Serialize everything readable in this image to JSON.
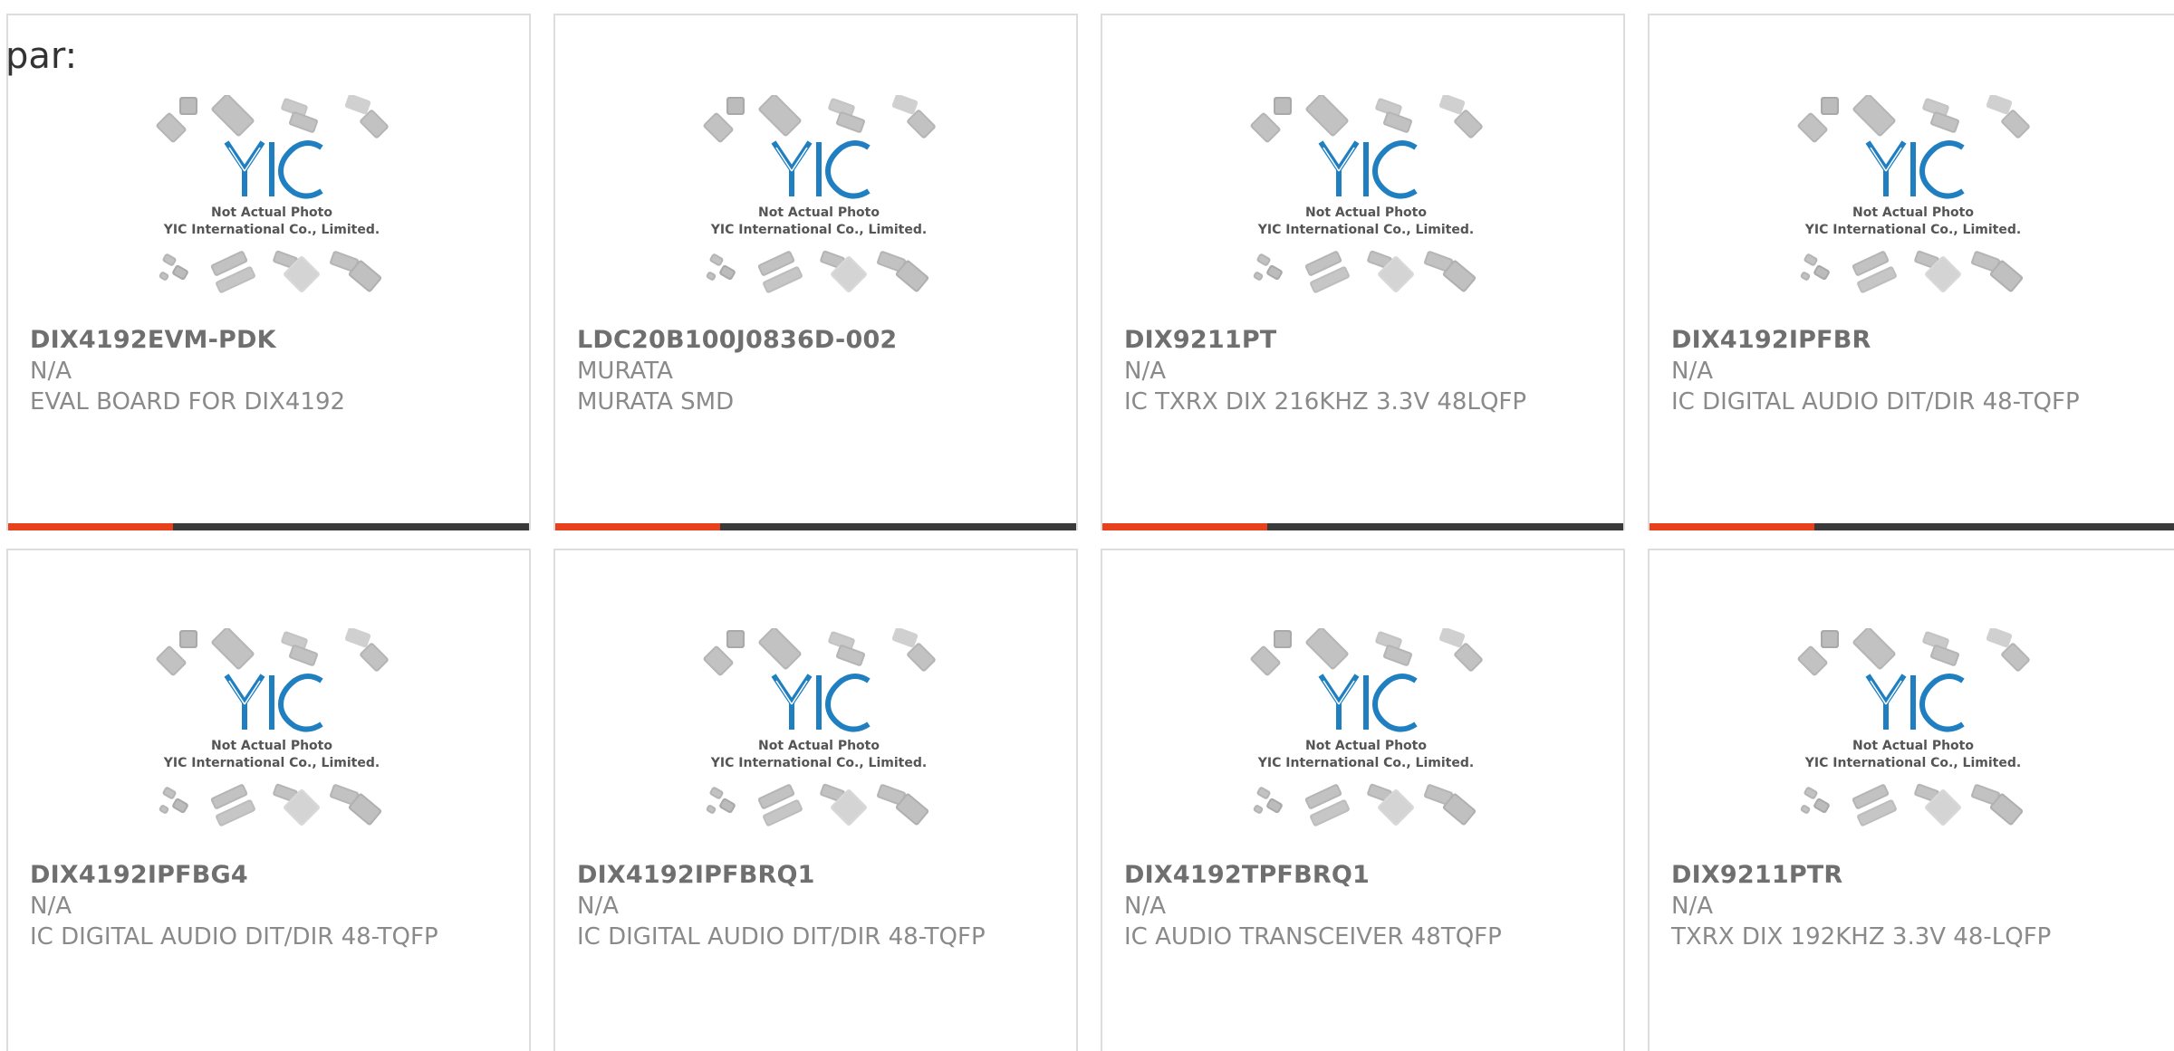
{
  "orphan_text": "par:",
  "placeholder_image": {
    "logo_text": "YIC",
    "line1": "Not Actual Photo",
    "line2": "YIC International Co., Limited."
  },
  "colors": {
    "accent": "#e8411e",
    "bar": "#3a3a3a",
    "logo_blue": "#1f7fc0",
    "chip_gray": "#b5b5b5"
  },
  "products": [
    {
      "part_no": "DIX4192EVM-PDK",
      "manufacturer": "N/A",
      "description": "EVAL BOARD FOR DIX4192"
    },
    {
      "part_no": "LDC20B100J0836D-002",
      "manufacturer": "MURATA",
      "description": "MURATA SMD"
    },
    {
      "part_no": "DIX9211PT",
      "manufacturer": "N/A",
      "description": "IC TXRX DIX 216KHZ 3.3V 48LQFP"
    },
    {
      "part_no": "DIX4192IPFBR",
      "manufacturer": "N/A",
      "description": "IC DIGITAL AUDIO DIT/DIR 48-TQFP"
    },
    {
      "part_no": "DIX4192IPFBG4",
      "manufacturer": "N/A",
      "description": "IC DIGITAL AUDIO DIT/DIR 48-TQFP"
    },
    {
      "part_no": "DIX4192IPFBRQ1",
      "manufacturer": "N/A",
      "description": "IC DIGITAL AUDIO DIT/DIR 48-TQFP"
    },
    {
      "part_no": "DIX4192TPFBRQ1",
      "manufacturer": "N/A",
      "description": "IC AUDIO TRANSCEIVER 48TQFP"
    },
    {
      "part_no": "DIX9211PTR",
      "manufacturer": "N/A",
      "description": "TXRX DIX 192KHZ 3.3V 48-LQFP"
    }
  ]
}
